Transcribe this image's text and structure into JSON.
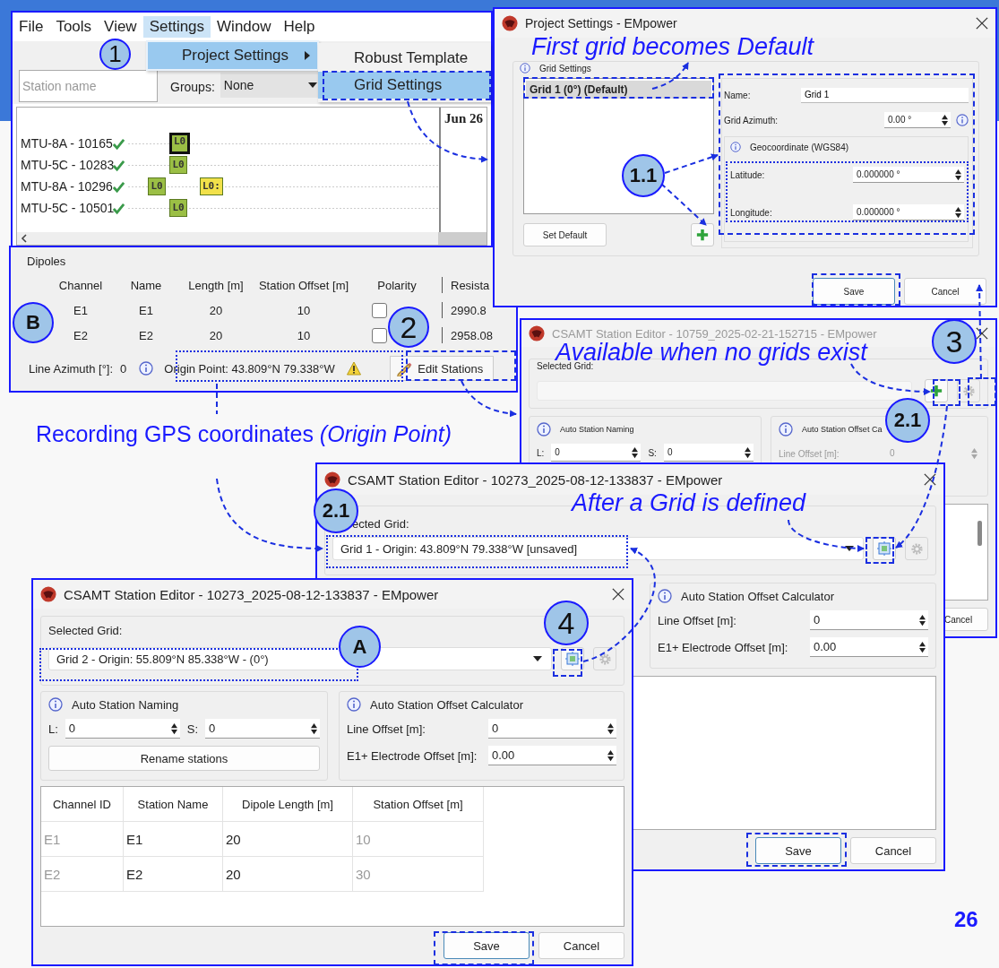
{
  "main_window": {
    "menu_bar": [
      {
        "label": "File",
        "selected": false
      },
      {
        "label": "Tools",
        "selected": false
      },
      {
        "label": "View",
        "selected": false
      },
      {
        "label": "Settings",
        "selected": true
      },
      {
        "label": "Window",
        "selected": false
      },
      {
        "label": "Help",
        "selected": false
      }
    ],
    "settings_menu": [
      {
        "label": "Project Settings",
        "selected": true,
        "submenu": true
      }
    ],
    "project_settings_submenu": [
      {
        "label": "Robust Template",
        "selected": false
      },
      {
        "label": "Grid Settings",
        "selected": true
      }
    ],
    "station_search": {
      "placeholder": "Station name"
    },
    "groups": {
      "label": "Groups:",
      "value": "None"
    },
    "timeline": {
      "date": "Jun 26",
      "stations": [
        {
          "name": "MTU-8A - 10165",
          "ok": true,
          "tags": [
            {
              "label": "L0",
              "color": "#9bbf45",
              "selected": true
            }
          ]
        },
        {
          "name": "MTU-5C - 10283",
          "ok": true,
          "tags": [
            {
              "label": "L0",
              "color": "#9bbf45",
              "selected": false
            }
          ]
        },
        {
          "name": "MTU-8A - 10296",
          "ok": true,
          "tags": [
            {
              "label": "L0",
              "color": "#9bbf45",
              "selected": false
            },
            {
              "label": "L0:",
              "color": "#f2e14a",
              "selected": false
            }
          ]
        },
        {
          "name": "MTU-5C - 10501",
          "ok": true,
          "tags": [
            {
              "label": "L0",
              "color": "#9bbf45",
              "selected": false
            }
          ]
        }
      ]
    },
    "dipoles": {
      "title": "Dipoles",
      "columns": [
        "Channel",
        "Name",
        "Length [m]",
        "Station Offset [m]",
        "Polarity",
        "Resista"
      ],
      "rows": [
        {
          "cells": [
            "E1",
            "E1",
            "20",
            "10"
          ],
          "inverted": false,
          "resistance": "2990.8"
        },
        {
          "cells": [
            "E2",
            "E2",
            "20",
            "10"
          ],
          "inverted": false,
          "resistance": "2958.08"
        }
      ],
      "line_azimuth_label": "Line Azimuth [°]:",
      "line_azimuth_value": "0",
      "origin_point": "Origin Point:  43.809°N 79.338°W",
      "origin_warning": true,
      "edit_button": "Edit Stations"
    }
  },
  "project_settings": {
    "title": "Project Settings - EMpower",
    "group_title": "Grid Settings",
    "grids": [
      {
        "label": "Grid 1 (0°) (Default)",
        "selected": true
      }
    ],
    "set_default_button": "Set Default",
    "name_label": "Name:",
    "name_value": "Grid 1",
    "azimuth_label": "Grid Azimuth:",
    "azimuth_value": "0.00 °",
    "geo_title": "Geocoordinate (WGS84)",
    "latitude_label": "Latitude:",
    "latitude_value": "0.000000 °",
    "longitude_label": "Longitude:",
    "longitude_value": "0.000000 °",
    "buttons": [
      {
        "label": "Save",
        "default": true
      },
      {
        "label": "Cancel",
        "default": false
      }
    ]
  },
  "station_editors": [
    {
      "title": "CSAMT Station Editor - 10759_2025-02-21-152715 - EMpower",
      "active": false,
      "selected_grid": {
        "label": "Selected Grid:",
        "disabled": true
      },
      "tools": [
        {
          "kind": "add",
          "disabled": false
        },
        {
          "kind": "settings",
          "disabled": true
        }
      ],
      "naming": {
        "title": "Auto Station Naming",
        "fields": [
          {
            "label": "L:",
            "value": "0"
          },
          {
            "label": "S:",
            "value": "0"
          }
        ]
      },
      "offset": {
        "title": "Auto Station Offset Ca",
        "fields": [
          {
            "label": "Line Offset [m]:",
            "value": "0",
            "disabled": true
          }
        ]
      },
      "buttons": [
        {
          "label": "Cancel",
          "default": false
        }
      ]
    },
    {
      "title": "CSAMT Station Editor - 10273_2025-08-12-133837 - EMpower",
      "active": true,
      "selected_grid": {
        "label": "ected Grid:",
        "value": "Grid 1 - Origin: 43.809°N 79.338°W [unsaved]",
        "disabled": false
      },
      "tools": [
        {
          "kind": "grid",
          "disabled": false
        },
        {
          "kind": "settings",
          "disabled": true
        }
      ],
      "offset": {
        "title": "Auto Station Offset Calculator",
        "fields": [
          {
            "label": "Line Offset [m]:",
            "value": "0",
            "disabled": false
          },
          {
            "label": "E1+ Electrode Offset [m]:",
            "value": "0.00",
            "disabled": false
          }
        ]
      },
      "buttons": [
        {
          "label": "Save",
          "default": true
        },
        {
          "label": "Cancel",
          "default": false
        }
      ]
    },
    {
      "title": "CSAMT Station Editor - 10273_2025-08-12-133837 - EMpower",
      "active": true,
      "selected_grid": {
        "label": "Selected Grid:",
        "value": "Grid 2 - Origin: 55.809°N 85.338°W - (0°)",
        "disabled": false
      },
      "tools": [
        {
          "kind": "grid",
          "disabled": false
        },
        {
          "kind": "settings",
          "disabled": true
        }
      ],
      "naming": {
        "title": "Auto Station Naming",
        "fields": [
          {
            "label": "L:",
            "value": "0"
          },
          {
            "label": "S:",
            "value": "0"
          }
        ],
        "button": "Rename stations"
      },
      "offset": {
        "title": "Auto Station Offset Calculator",
        "fields": [
          {
            "label": "Line Offset [m]:",
            "value": "0",
            "disabled": false
          },
          {
            "label": "E1+ Electrode Offset [m]:",
            "value": "0.00",
            "disabled": false
          }
        ]
      },
      "table": {
        "columns": [
          "Channel ID",
          "Station Name",
          "Dipole Length [m]",
          "Station Offset [m]"
        ],
        "rows": [
          {
            "cells": [
              {
                "text": "E1",
                "disabled": true
              },
              {
                "text": "E1",
                "disabled": false
              },
              {
                "text": "20",
                "disabled": false
              },
              {
                "text": "10",
                "disabled": true
              }
            ]
          },
          {
            "cells": [
              {
                "text": "E2",
                "disabled": true
              },
              {
                "text": "E2",
                "disabled": false
              },
              {
                "text": "20",
                "disabled": false
              },
              {
                "text": "30",
                "disabled": true
              }
            ]
          }
        ]
      },
      "buttons": [
        {
          "label": "Save",
          "default": true
        },
        {
          "label": "Cancel",
          "default": false
        }
      ]
    }
  ],
  "callouts": [
    {
      "label": "1",
      "kind": "step"
    },
    {
      "label": "B",
      "kind": "label"
    },
    {
      "label": "2",
      "kind": "step"
    },
    {
      "label": "1.1",
      "kind": "label"
    },
    {
      "label": "3",
      "kind": "step"
    },
    {
      "label": "2.1",
      "kind": "label"
    },
    {
      "label": "2.1",
      "kind": "label"
    },
    {
      "label": "4",
      "kind": "step"
    },
    {
      "label": "A",
      "kind": "label"
    }
  ],
  "notes": [
    "First grid becomes Default",
    "Available when no grids exist",
    "Recording GPS coordinates *(Origin Point)*",
    "After a Grid is defined"
  ],
  "page_number": "26"
}
